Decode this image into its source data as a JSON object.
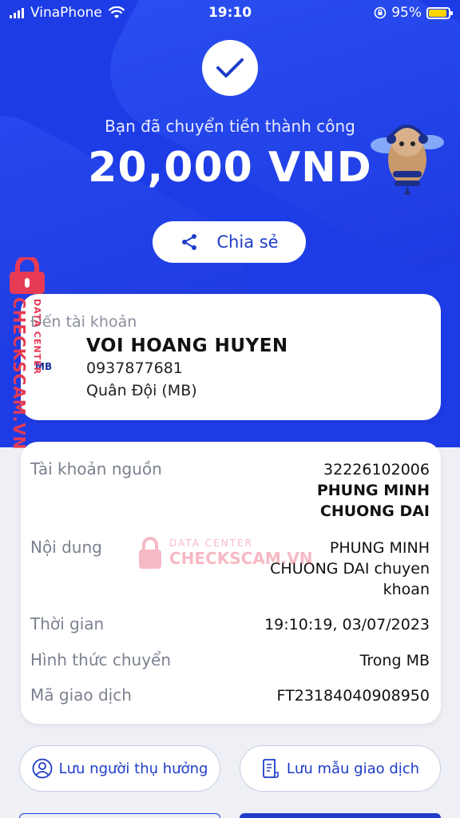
{
  "status_bar": {
    "carrier": "VinaPhone",
    "time": "19:10",
    "battery": "95%"
  },
  "hero": {
    "success_message": "Bạn đã chuyển tiền thành công",
    "amount": "20,000 VND",
    "share_label": "Chia sẻ"
  },
  "recipient": {
    "label": "Đến tài khoản",
    "name": "VOI HOANG HUYEN",
    "account": "0937877681",
    "bank": "Quân Đội (MB)",
    "bank_logo": "MB"
  },
  "details": {
    "source_account": {
      "label": "Tài khoản nguồn",
      "number": "32226102006",
      "owner_line1": "PHUNG MINH",
      "owner_line2": "CHUONG DAI"
    },
    "content": {
      "label": "Nội dung",
      "line1": "PHUNG MINH",
      "line2": "CHUONG DAI chuyen",
      "line3": "khoan"
    },
    "time": {
      "label": "Thời gian",
      "value": "19:10:19, 03/07/2023"
    },
    "method": {
      "label": "Hình thức chuyển",
      "value": "Trong MB"
    },
    "transaction_id": {
      "label": "Mã giao dịch",
      "value": "FT23184040908950"
    }
  },
  "actions": {
    "save_beneficiary": "Lưu người thụ hưởng",
    "save_template": "Lưu mẫu giao dịch"
  },
  "watermark": {
    "side_main": "CHECKSCAM.VN",
    "side_sub": "DATA CENTER",
    "center_top": "DATA CENTER",
    "center_main": "CHECKSCAM.VN"
  },
  "colors": {
    "primary": "#1e3ce6",
    "button_text": "#1f3cc8",
    "watermark": "#e63a55"
  },
  "icons": [
    "wifi-icon",
    "signal-icon",
    "battery-icon",
    "check-icon",
    "share-icon",
    "user-icon",
    "document-icon",
    "lock-icon"
  ]
}
